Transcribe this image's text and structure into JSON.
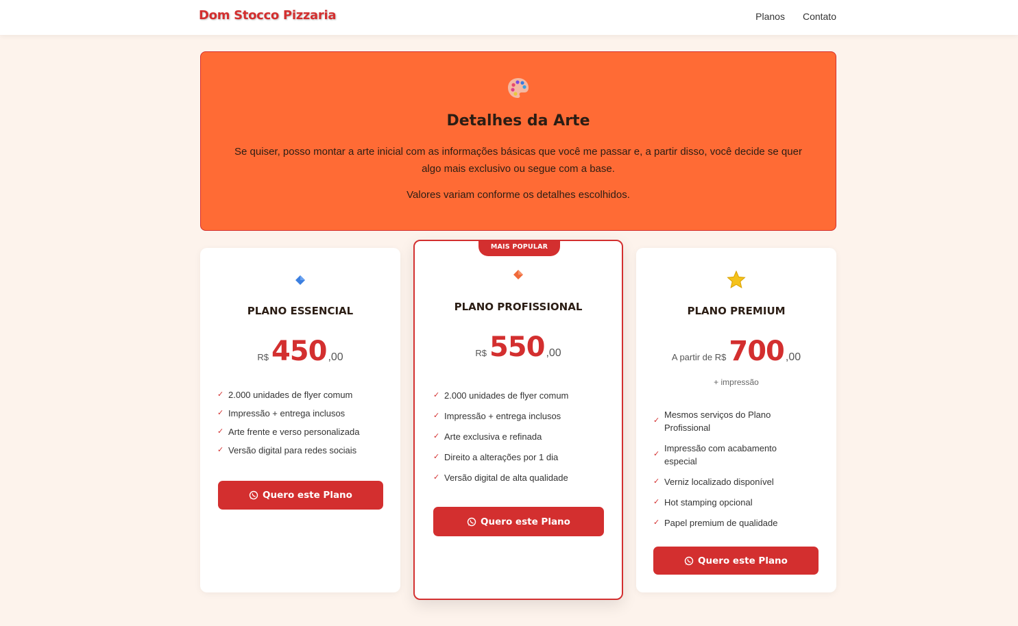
{
  "header": {
    "brand": "Dom Stocco Pizzaria",
    "nav": [
      "Planos",
      "Contato"
    ]
  },
  "banner": {
    "icon": "palette-icon",
    "title": "Detalhes da Arte",
    "text1": "Se quiser, posso montar a arte inicial com as informações básicas que você me passar e, a partir disso, você decide se quer algo mais exclusivo ou segue com a base.",
    "text2": "Valores variam conforme os detalhes escolhidos.",
    "color": "#ff6b35"
  },
  "plans": [
    {
      "icon": "blue-diamond-icon",
      "name": "PLANO ESSENCIAL",
      "currency": "R$",
      "amount": "450",
      "cents": ",00",
      "features": [
        "2.000 unidades de flyer comum",
        "Impressão + entrega inclusos",
        "Arte frente e verso personalizada",
        "Versão digital para redes sociais"
      ],
      "cta": "Quero este Plano"
    },
    {
      "badge": "MAIS POPULAR",
      "icon": "orange-diamond-icon",
      "name": "PLANO PROFISSIONAL",
      "currency": "R$",
      "amount": "550",
      "cents": ",00",
      "features": [
        "2.000 unidades de flyer comum",
        "Impressão + entrega inclusos",
        "Arte exclusiva e refinada",
        "Direito a alterações por 1 dia",
        "Versão digital de alta qualidade"
      ],
      "cta": "Quero este Plano"
    },
    {
      "icon": "star-icon",
      "name": "PLANO PREMIUM",
      "currency": "A partir de R$",
      "amount": "700",
      "cents": ",00",
      "note": "+ impressão",
      "features": [
        "Mesmos serviços do Plano Profissional",
        "Impressão com acabamento especial",
        "Verniz localizado disponível",
        "Hot stamping opcional",
        "Papel premium de qualidade"
      ],
      "cta": "Quero este Plano"
    }
  ],
  "colors": {
    "accent": "#d32f2f",
    "background": "#fdf3ec"
  }
}
